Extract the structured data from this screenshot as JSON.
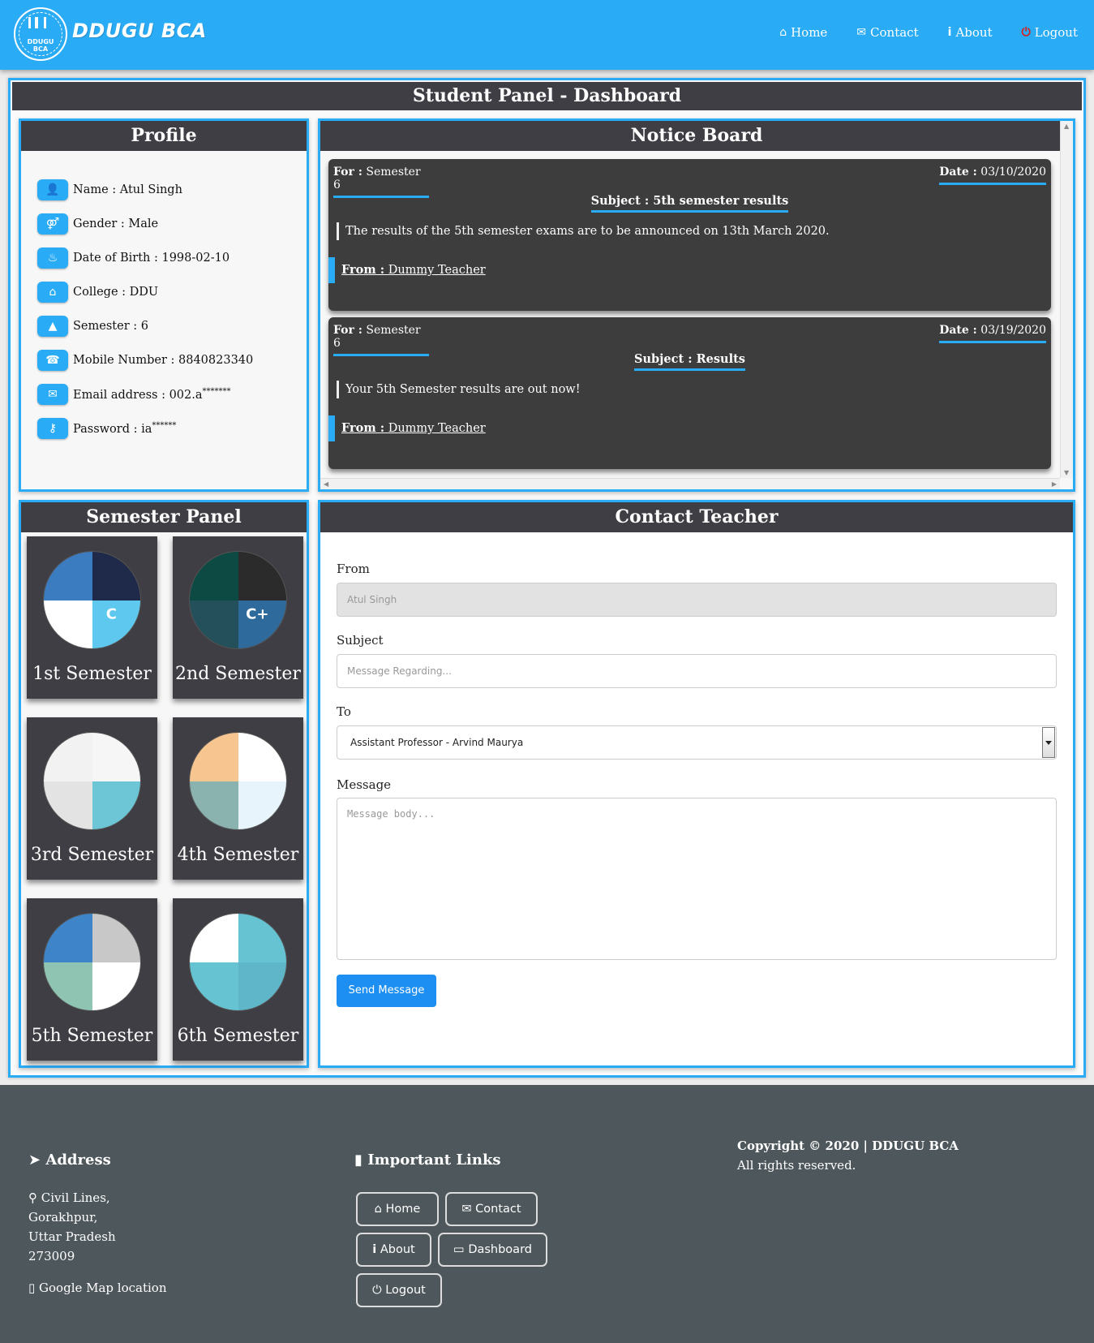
{
  "nav": {
    "brand": "DDUGU BCA",
    "logo_text_top": "DDUGU",
    "logo_text_bottom": "BCA",
    "links": [
      {
        "icon": "home-icon",
        "label": "Home"
      },
      {
        "icon": "envelope-icon",
        "label": "Contact"
      },
      {
        "icon": "info-icon",
        "label": "About"
      },
      {
        "icon": "power-icon",
        "label": "Logout"
      }
    ]
  },
  "dashboard_title": "Student Panel - Dashboard",
  "profile": {
    "title": "Profile",
    "rows": [
      {
        "icon": "user-icon",
        "text": "Name : Atul Singh"
      },
      {
        "icon": "gender-icon",
        "text": "Gender : Male"
      },
      {
        "icon": "birthday-cake-icon",
        "text": "Date of Birth : 1998-02-10"
      },
      {
        "icon": "institution-icon",
        "text": "College : DDU"
      },
      {
        "icon": "graduation-cap-icon",
        "text": "Semester : 6"
      },
      {
        "icon": "phone-icon",
        "text": "Mobile Number : 8840823340"
      },
      {
        "icon": "envelope-icon",
        "text": "Email address : 002.a",
        "sup": "*******"
      },
      {
        "icon": "key-icon",
        "text": "Password : ia",
        "sup": "******"
      }
    ]
  },
  "notice_board": {
    "title": "Notice Board",
    "notices": [
      {
        "for_label": "For :",
        "for_value": "Semester 6",
        "date_label": "Date :",
        "date_value": "03/10/2020",
        "subject": "Subject : 5th semester results",
        "body": "The results of the 5th semester exams are to be announced on 13th March 2020.",
        "from_label": "From :",
        "from_value": "Dummy Teacher"
      },
      {
        "for_label": "For :",
        "for_value": "Semester 6",
        "date_label": "Date :",
        "date_value": "03/19/2020",
        "subject": "Subject : Results",
        "body": "Your 5th Semester results are out now!",
        "from_label": "From :",
        "from_value": "Dummy Teacher"
      }
    ]
  },
  "semester_panel": {
    "title": "Semester Panel",
    "semesters": [
      {
        "label": "1st Semester",
        "colors": [
          "#3b7bbf",
          "#1f2a4a",
          "#ffffff",
          "#5fc8ee"
        ]
      },
      {
        "label": "2nd Semester",
        "colors": [
          "#0d4a44",
          "#2b2b2b",
          "#23505a",
          "#2f6a9c"
        ]
      },
      {
        "label": "3rd Semester",
        "colors": [
          "#f2f2f2",
          "#f6f6f6",
          "#e3e3e3",
          "#6cc6d6"
        ]
      },
      {
        "label": "4th Semester",
        "colors": [
          "#f7c58f",
          "#ffffff",
          "#8ab3b0",
          "#e8f4fb"
        ]
      },
      {
        "label": "5th Semester",
        "colors": [
          "#3d84c8",
          "#c8c8c8",
          "#8fc4b2",
          "#ffffff"
        ]
      },
      {
        "label": "6th Semester",
        "colors": [
          "#ffffff",
          "#66c3d2",
          "#66c3d2",
          "#5fb6c9"
        ]
      }
    ]
  },
  "contact_teacher": {
    "title": "Contact Teacher",
    "from_label": "From",
    "from_value": "Atul Singh",
    "subject_label": "Subject",
    "subject_placeholder": "Message Regarding...",
    "to_label": "To",
    "to_selected": "Assistant Professor - Arvind Maurya",
    "message_label": "Message",
    "message_placeholder": "Message body...",
    "send_label": "Send Message"
  },
  "footer": {
    "address_heading": "Address",
    "address_lines": [
      "Civil Lines,",
      "Gorakhpur,",
      "Uttar Pradesh",
      "273009"
    ],
    "map_link": "Google Map location",
    "links_heading": "Important Links",
    "links": [
      {
        "icon": "home-icon",
        "label": "Home"
      },
      {
        "icon": "envelope-icon",
        "label": "Contact"
      },
      {
        "icon": "info-icon",
        "label": "About"
      },
      {
        "icon": "desktop-icon",
        "label": "Dashboard"
      },
      {
        "icon": "power-icon",
        "label": "Logout"
      }
    ],
    "copyright": "Copyright © 2020 | DDUGU BCA",
    "rights": "All rights reserved."
  },
  "colors": {
    "accent": "#2aabf6",
    "panel_header": "#3e3e44",
    "footer_bg": "#4e575c",
    "button": "#1e8ff2"
  }
}
